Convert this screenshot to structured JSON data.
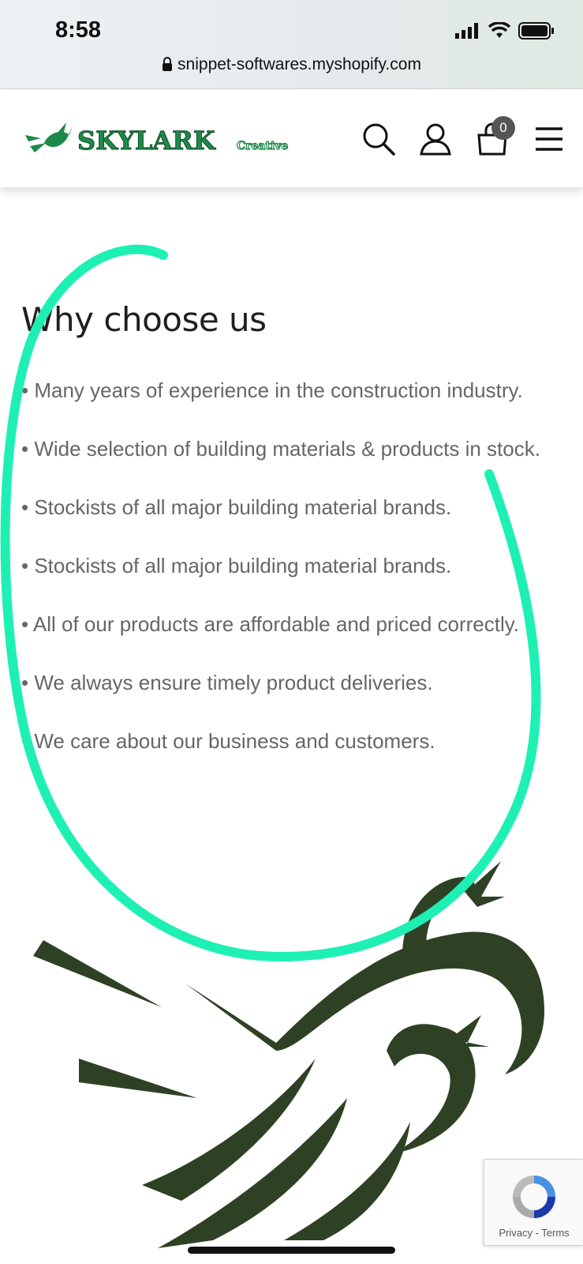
{
  "status_bar": {
    "time": "8:58"
  },
  "browser": {
    "url": "snippet-softwares.myshopify.com"
  },
  "header": {
    "logo_text": "SKYLARK",
    "logo_subtext": "Creative",
    "cart_count": "0",
    "icons": [
      "search-icon",
      "account-icon",
      "cart-icon",
      "menu-icon"
    ]
  },
  "section": {
    "title": "Why choose us",
    "items": [
      "• Many years of experience in the construction industry.",
      "• Wide selection of building materials & products in stock.",
      "• Stockists of all major building material brands.",
      "• Stockists of all major building material brands.",
      "• All of our products are affordable and priced correctly.",
      "• We always ensure timely product deliveries.",
      "• We care about our business and customers."
    ]
  },
  "recaptcha": {
    "privacy": "Privacy",
    "separator": " - ",
    "terms": "Terms"
  },
  "colors": {
    "brand_green": "#1e8a4a",
    "bird_dark": "#2f4124",
    "annotation": "#1ef0b4",
    "body_text": "#666666"
  }
}
